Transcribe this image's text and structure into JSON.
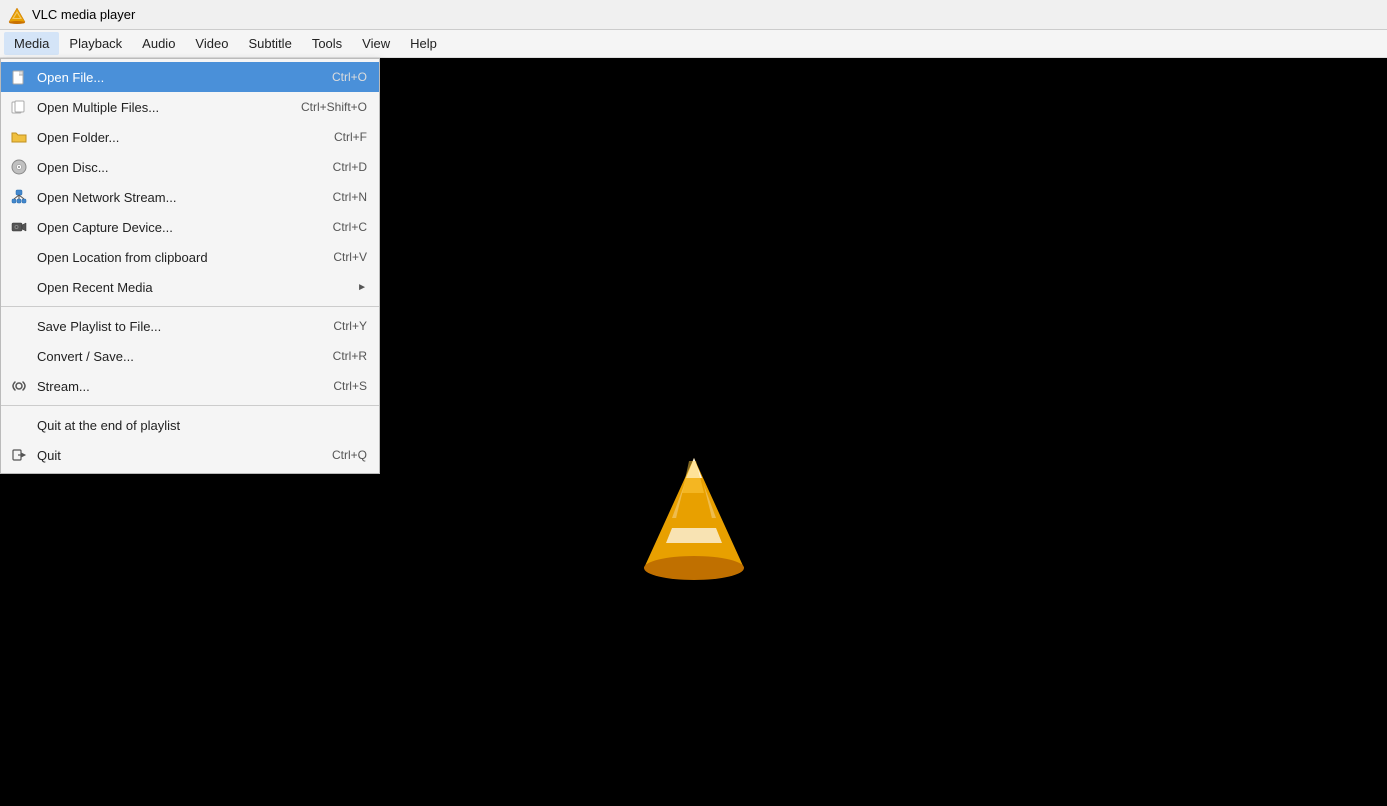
{
  "titlebar": {
    "title": "VLC media player"
  },
  "menubar": {
    "items": [
      {
        "id": "media",
        "label": "Media",
        "active": true
      },
      {
        "id": "playback",
        "label": "Playback",
        "active": false
      },
      {
        "id": "audio",
        "label": "Audio",
        "active": false
      },
      {
        "id": "video",
        "label": "Video",
        "active": false
      },
      {
        "id": "subtitle",
        "label": "Subtitle",
        "active": false
      },
      {
        "id": "tools",
        "label": "Tools",
        "active": false
      },
      {
        "id": "view",
        "label": "View",
        "active": false
      },
      {
        "id": "help",
        "label": "Help",
        "active": false
      }
    ]
  },
  "media_menu": {
    "items": [
      {
        "id": "open-file",
        "label": "Open File...",
        "shortcut": "Ctrl+O",
        "icon": "📄",
        "highlighted": true,
        "separator_after": false
      },
      {
        "id": "open-multiple",
        "label": "Open Multiple Files...",
        "shortcut": "Ctrl+Shift+O",
        "icon": "📋",
        "highlighted": false,
        "separator_after": false
      },
      {
        "id": "open-folder",
        "label": "Open Folder...",
        "shortcut": "Ctrl+F",
        "icon": "📁",
        "highlighted": false,
        "separator_after": false
      },
      {
        "id": "open-disc",
        "label": "Open Disc...",
        "shortcut": "Ctrl+D",
        "icon": "💿",
        "highlighted": false,
        "separator_after": false
      },
      {
        "id": "open-network",
        "label": "Open Network Stream...",
        "shortcut": "Ctrl+N",
        "icon": "🌐",
        "highlighted": false,
        "separator_after": false
      },
      {
        "id": "open-capture",
        "label": "Open Capture Device...",
        "shortcut": "Ctrl+C",
        "icon": "📷",
        "highlighted": false,
        "separator_after": false
      },
      {
        "id": "open-location",
        "label": "Open Location from clipboard",
        "shortcut": "Ctrl+V",
        "icon": "",
        "highlighted": false,
        "separator_after": false
      },
      {
        "id": "open-recent",
        "label": "Open Recent Media",
        "shortcut": "",
        "icon": "",
        "highlighted": false,
        "has_arrow": true,
        "separator_after": true
      },
      {
        "id": "save-playlist",
        "label": "Save Playlist to File...",
        "shortcut": "Ctrl+Y",
        "icon": "",
        "highlighted": false,
        "separator_after": false
      },
      {
        "id": "convert-save",
        "label": "Convert / Save...",
        "shortcut": "Ctrl+R",
        "icon": "",
        "highlighted": false,
        "separator_after": false
      },
      {
        "id": "stream",
        "label": "Stream...",
        "shortcut": "Ctrl+S",
        "icon": "📡",
        "highlighted": false,
        "separator_after": true
      },
      {
        "id": "quit-end",
        "label": "Quit at the end of playlist",
        "shortcut": "",
        "icon": "",
        "highlighted": false,
        "separator_after": false
      },
      {
        "id": "quit",
        "label": "Quit",
        "shortcut": "Ctrl+Q",
        "icon": "🚪",
        "highlighted": false,
        "separator_after": false
      }
    ]
  }
}
